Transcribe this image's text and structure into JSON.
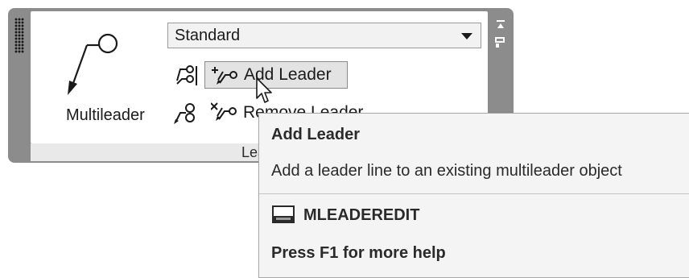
{
  "panel": {
    "footer_label": "Leaders"
  },
  "multileader": {
    "label": "Multileader",
    "icon": "multileader-icon"
  },
  "style_dropdown": {
    "value": "Standard",
    "icon": "chevron-down-icon"
  },
  "tools": {
    "add_leader_label": "Add Leader",
    "remove_leader_label": "Remove Leader"
  },
  "tooltip": {
    "title": "Add Leader",
    "description": "Add a leader line to an existing multileader object",
    "command": "MLEADEREDIT",
    "help": "Press F1 for more help"
  },
  "colors": {
    "panel_frame": "#8c8c8c",
    "panel_bg": "#ffffff",
    "footer_bg": "#e9e9e9",
    "highlight_bg": "#e3e3e3",
    "tooltip_bg": "#f4f4f4",
    "text": "#1a1a1a"
  }
}
